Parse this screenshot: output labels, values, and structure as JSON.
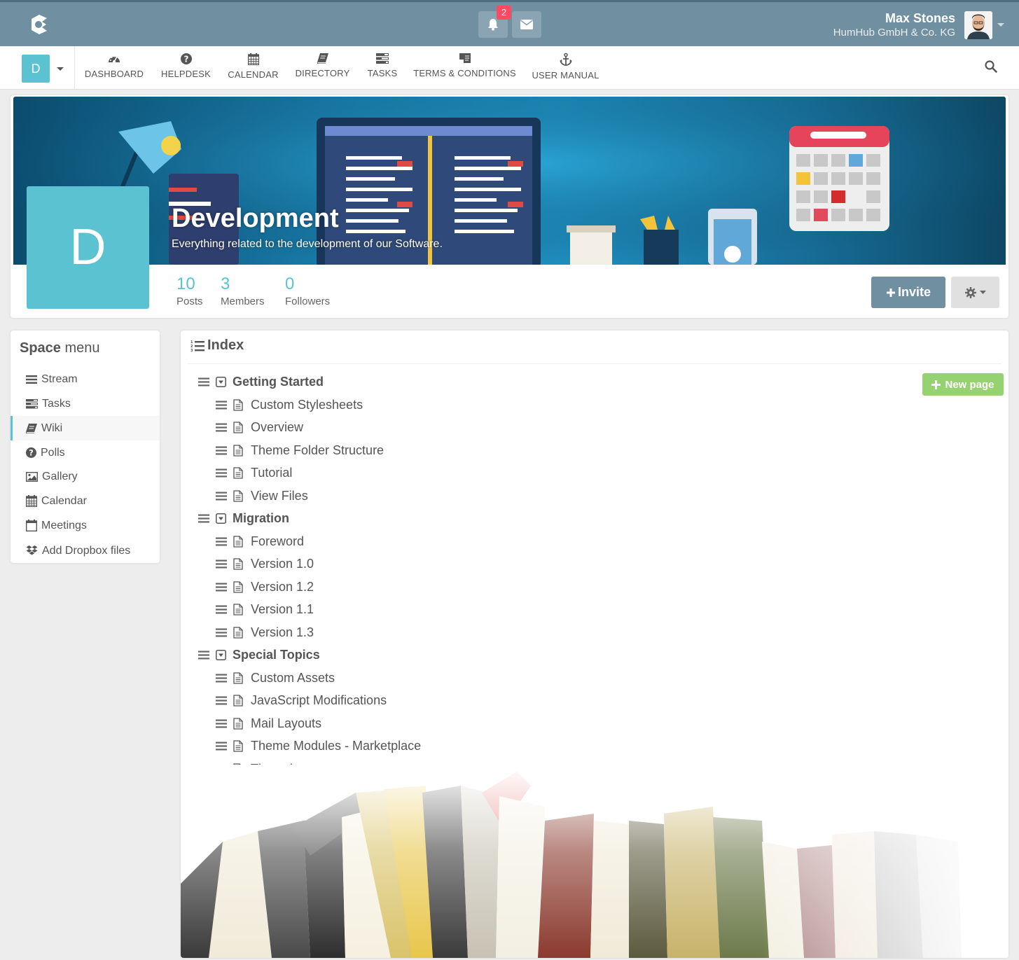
{
  "topbar": {
    "notification_count": "2",
    "user_name": "Max Stones",
    "user_org": "HumHub GmbH & Co. KG"
  },
  "nav": {
    "space_initial": "D",
    "items": [
      {
        "label": "DASHBOARD",
        "icon": "dashboard-icon"
      },
      {
        "label": "HELPDESK",
        "icon": "question-circle-icon"
      },
      {
        "label": "CALENDAR",
        "icon": "calendar-icon"
      },
      {
        "label": "DIRECTORY",
        "icon": "book-icon"
      },
      {
        "label": "TASKS",
        "icon": "tasks-icon"
      },
      {
        "label": "TERMS & CONDITIONS",
        "icon": "legal-icon"
      },
      {
        "label": "USER MANUAL",
        "icon": "anchor-icon"
      }
    ]
  },
  "space": {
    "initial": "D",
    "title": "Development",
    "description": "Everything related to the development of our Software.",
    "stats": [
      {
        "value": "10",
        "label": "Posts"
      },
      {
        "value": "3",
        "label": "Members"
      },
      {
        "value": "0",
        "label": "Followers"
      }
    ],
    "invite_label": "Invite"
  },
  "sidebar": {
    "title_bold": "Space",
    "title_rest": "menu",
    "items": [
      {
        "label": "Stream",
        "icon": "bars-icon",
        "active": false
      },
      {
        "label": "Tasks",
        "icon": "tasks-icon",
        "active": false
      },
      {
        "label": "Wiki",
        "icon": "book-icon",
        "active": true
      },
      {
        "label": "Polls",
        "icon": "question-circle-icon",
        "active": false
      },
      {
        "label": "Gallery",
        "icon": "picture-icon",
        "active": false
      },
      {
        "label": "Calendar",
        "icon": "calendar-icon",
        "active": false
      },
      {
        "label": "Meetings",
        "icon": "calendar-empty-icon",
        "active": false
      },
      {
        "label": "Add Dropbox files",
        "icon": "dropbox-icon",
        "active": false
      }
    ]
  },
  "wiki": {
    "title": "Index",
    "new_page_label": "New page",
    "categories": [
      {
        "title": "Getting Started",
        "pages": [
          "Custom Stylesheets",
          "Overview",
          "Theme Folder Structure",
          "Tutorial",
          "View Files"
        ]
      },
      {
        "title": "Migration",
        "pages": [
          "Foreword",
          "Version 1.0",
          "Version 1.2",
          "Version 1.1",
          "Version 1.3"
        ]
      },
      {
        "title": "Special Topics",
        "pages": [
          "Custom Assets",
          "JavaScript Modifications",
          "Mail Layouts",
          "Theme Modules - Marketplace",
          "Themeing"
        ]
      }
    ]
  },
  "colors": {
    "topbar": "#708fa0",
    "accent": "#5bc2d2",
    "success": "#97d271",
    "badge": "#fc4a64"
  }
}
